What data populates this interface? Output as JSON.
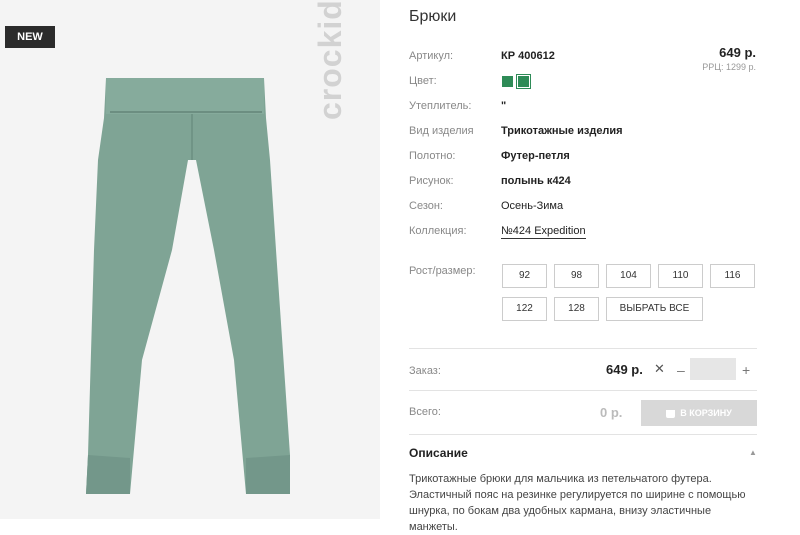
{
  "product": {
    "badge": "NEW",
    "brand": "crockid",
    "title": "Брюки",
    "price": "649 р.",
    "rrp": "РРЦ: 1299 р."
  },
  "colors": {
    "swatch": "#2e8b57",
    "photo_bg": "#f4f4f4",
    "pants": "#7fa495"
  },
  "attributes": [
    {
      "label": "Артикул:",
      "value": "КР 400612"
    },
    {
      "label": "Цвет:",
      "value": ""
    },
    {
      "label": "Утеплитель:",
      "value": "\""
    },
    {
      "label": "Вид изделия",
      "value": "Трикотажные изделия"
    },
    {
      "label": "Полотно:",
      "value": "Футер-петля"
    },
    {
      "label": "Рисунок:",
      "value": "полынь к424"
    },
    {
      "label": "Сезон:",
      "value": "Осень-Зима"
    },
    {
      "label": "Коллекция:",
      "value": "№424 Expedition"
    }
  ],
  "sizes": {
    "label": "Рост/размер:",
    "options": [
      "92",
      "98",
      "104",
      "110",
      "116",
      "122",
      "128"
    ],
    "select_all": "ВЫБРАТЬ ВСЕ"
  },
  "order": {
    "label": "Заказ:",
    "price": "649 р.",
    "times": "✕",
    "minus": "–",
    "plus": "+",
    "quantity": ""
  },
  "total": {
    "label": "Всего:",
    "value": "0 р.",
    "cart_button": "В КОРЗИНУ"
  },
  "description": {
    "heading": "Описание",
    "text": "Трикотажные брюки для мальчика из петельчатого футера. Эластичный пояс на резинке регулируется по ширине с помощью шнурка, по бокам два удобных кармана, внизу эластичные манжеты."
  }
}
